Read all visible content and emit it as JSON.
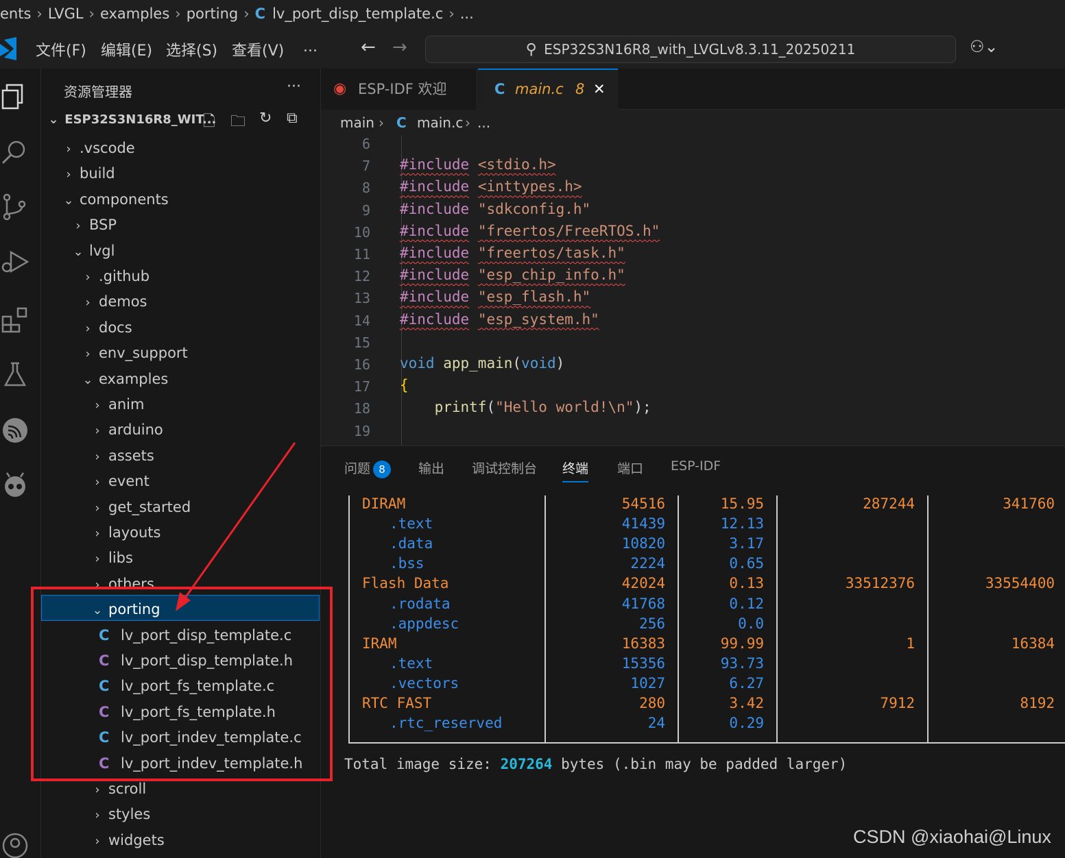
{
  "breadcrumb_top": [
    "ents",
    "LVGL",
    "examples",
    "porting",
    "lv_port_disp_template.c",
    "..."
  ],
  "menu": [
    "文件(F)",
    "编辑(E)",
    "选择(S)",
    "查看(V)",
    "..."
  ],
  "command_center": "ESP32S3N16R8_with_LVGLv8.3.11_20250211",
  "explorer": {
    "title": "资源管理器",
    "more": "···",
    "root": "ESP32S3N16R8_WIT...",
    "tree": [
      {
        "label": ".vscode",
        "type": "folder",
        "open": false,
        "depth": 0
      },
      {
        "label": "build",
        "type": "folder",
        "open": false,
        "depth": 0
      },
      {
        "label": "components",
        "type": "folder",
        "open": true,
        "depth": 0
      },
      {
        "label": "BSP",
        "type": "folder",
        "open": false,
        "depth": 1
      },
      {
        "label": "lvgl",
        "type": "folder",
        "open": true,
        "depth": 1
      },
      {
        "label": ".github",
        "type": "folder",
        "open": false,
        "depth": 2
      },
      {
        "label": "demos",
        "type": "folder",
        "open": false,
        "depth": 2
      },
      {
        "label": "docs",
        "type": "folder",
        "open": false,
        "depth": 2
      },
      {
        "label": "env_support",
        "type": "folder",
        "open": false,
        "depth": 2
      },
      {
        "label": "examples",
        "type": "folder",
        "open": true,
        "depth": 2
      },
      {
        "label": "anim",
        "type": "folder",
        "open": false,
        "depth": 3
      },
      {
        "label": "arduino",
        "type": "folder",
        "open": false,
        "depth": 3
      },
      {
        "label": "assets",
        "type": "folder",
        "open": false,
        "depth": 3
      },
      {
        "label": "event",
        "type": "folder",
        "open": false,
        "depth": 3
      },
      {
        "label": "get_started",
        "type": "folder",
        "open": false,
        "depth": 3
      },
      {
        "label": "layouts",
        "type": "folder",
        "open": false,
        "depth": 3
      },
      {
        "label": "libs",
        "type": "folder",
        "open": false,
        "depth": 3
      },
      {
        "label": "others",
        "type": "folder",
        "open": false,
        "depth": 3
      },
      {
        "label": "porting",
        "type": "folder",
        "open": true,
        "depth": 3
      },
      {
        "label": "lv_port_disp_template.c",
        "type": "c",
        "depth": 4
      },
      {
        "label": "lv_port_disp_template.h",
        "type": "h",
        "depth": 4
      },
      {
        "label": "lv_port_fs_template.c",
        "type": "c",
        "depth": 4
      },
      {
        "label": "lv_port_fs_template.h",
        "type": "h",
        "depth": 4
      },
      {
        "label": "lv_port_indev_template.c",
        "type": "c",
        "depth": 4
      },
      {
        "label": "lv_port_indev_template.h",
        "type": "h",
        "depth": 4
      },
      {
        "label": "scroll",
        "type": "folder",
        "open": false,
        "depth": 3
      },
      {
        "label": "styles",
        "type": "folder",
        "open": false,
        "depth": 3
      },
      {
        "label": "widgets",
        "type": "folder",
        "open": false,
        "depth": 3
      }
    ]
  },
  "tabs": {
    "esp": "ESP-IDF 欢迎",
    "main": "main.c",
    "main_problems": "8",
    "close": "✕"
  },
  "editor_breadcrumb": [
    "main",
    "main.c",
    "..."
  ],
  "code_lines": [
    {
      "n": "6",
      "parts": []
    },
    {
      "n": "7",
      "parts": [
        [
          "kw sq",
          "#include"
        ],
        [
          "plain",
          " "
        ],
        [
          "str sq",
          "<stdio.h>"
        ]
      ]
    },
    {
      "n": "8",
      "parts": [
        [
          "kw sq",
          "#include"
        ],
        [
          "plain",
          " "
        ],
        [
          "str sq",
          "<inttypes.h>"
        ]
      ]
    },
    {
      "n": "9",
      "parts": [
        [
          "kw",
          "#include"
        ],
        [
          "plain",
          " "
        ],
        [
          "str",
          "\"sdkconfig.h\""
        ]
      ]
    },
    {
      "n": "10",
      "parts": [
        [
          "kw sq",
          "#include"
        ],
        [
          "plain",
          " "
        ],
        [
          "str sq",
          "\"freertos/FreeRTOS.h\""
        ]
      ]
    },
    {
      "n": "11",
      "parts": [
        [
          "kw sq",
          "#include"
        ],
        [
          "plain",
          " "
        ],
        [
          "str sq",
          "\"freertos/task.h\""
        ]
      ]
    },
    {
      "n": "12",
      "parts": [
        [
          "kw sq",
          "#include"
        ],
        [
          "plain",
          " "
        ],
        [
          "str sq",
          "\"esp_chip_info.h\""
        ]
      ]
    },
    {
      "n": "13",
      "parts": [
        [
          "kw sq",
          "#include"
        ],
        [
          "plain",
          " "
        ],
        [
          "str sq",
          "\"esp_flash.h\""
        ]
      ]
    },
    {
      "n": "14",
      "parts": [
        [
          "kw sq",
          "#include"
        ],
        [
          "plain",
          " "
        ],
        [
          "str sq",
          "\"esp_system.h\""
        ]
      ]
    },
    {
      "n": "15",
      "parts": []
    },
    {
      "n": "16",
      "parts": [
        [
          "kwb",
          "void"
        ],
        [
          "plain",
          " "
        ],
        [
          "fn",
          "app_main"
        ],
        [
          "plain",
          "("
        ],
        [
          "kwb",
          "void"
        ],
        [
          "plain",
          ")"
        ]
      ]
    },
    {
      "n": "17",
      "parts": [
        [
          "brace",
          "{"
        ]
      ]
    },
    {
      "n": "18",
      "parts": [
        [
          "plain",
          "    "
        ],
        [
          "fn",
          "printf"
        ],
        [
          "plain",
          "("
        ],
        [
          "str",
          "\"Hello world!\\n\""
        ],
        [
          "plain",
          ");"
        ]
      ]
    },
    {
      "n": "19",
      "parts": []
    }
  ],
  "panel": {
    "problems": "问题",
    "problems_count": "8",
    "output": "输出",
    "debug": "调试控制台",
    "terminal": "终端",
    "ports": "端口",
    "espidf": "ESP-IDF"
  },
  "terminal_rows": [
    {
      "name": "DIRAM",
      "kind": "orange",
      "v1": "54516",
      "v2": "15.95",
      "v3": "287244",
      "v4": "341760"
    },
    {
      "name": ".text",
      "kind": "blue",
      "v1": "41439",
      "v2": "12.13",
      "v3": "",
      "v4": ""
    },
    {
      "name": ".data",
      "kind": "blue",
      "v1": "10820",
      "v2": "3.17",
      "v3": "",
      "v4": ""
    },
    {
      "name": ".bss",
      "kind": "blue",
      "v1": "2224",
      "v2": "0.65",
      "v3": "",
      "v4": ""
    },
    {
      "name": "Flash Data",
      "kind": "orange",
      "v1": "42024",
      "v2": "0.13",
      "v3": "33512376",
      "v4": "33554400"
    },
    {
      "name": ".rodata",
      "kind": "blue",
      "v1": "41768",
      "v2": "0.12",
      "v3": "",
      "v4": ""
    },
    {
      "name": ".appdesc",
      "kind": "blue",
      "v1": "256",
      "v2": "0.0",
      "v3": "",
      "v4": ""
    },
    {
      "name": "IRAM",
      "kind": "orange",
      "v1": "16383",
      "v2": "99.99",
      "v3": "1",
      "v4": "16384"
    },
    {
      "name": ".text",
      "kind": "blue",
      "v1": "15356",
      "v2": "93.73",
      "v3": "",
      "v4": ""
    },
    {
      "name": ".vectors",
      "kind": "blue",
      "v1": "1027",
      "v2": "6.27",
      "v3": "",
      "v4": ""
    },
    {
      "name": "RTC FAST",
      "kind": "orange",
      "v1": "280",
      "v2": "3.42",
      "v3": "7912",
      "v4": "8192"
    },
    {
      "name": ".rtc_reserved",
      "kind": "blue",
      "v1": "24",
      "v2": "0.29",
      "v3": "",
      "v4": ""
    }
  ],
  "total": {
    "prefix": "Total image size: ",
    "number": "207264",
    "suffix": " bytes (.bin may be padded larger)"
  },
  "watermark": "CSDN @xiaohai@Linux"
}
